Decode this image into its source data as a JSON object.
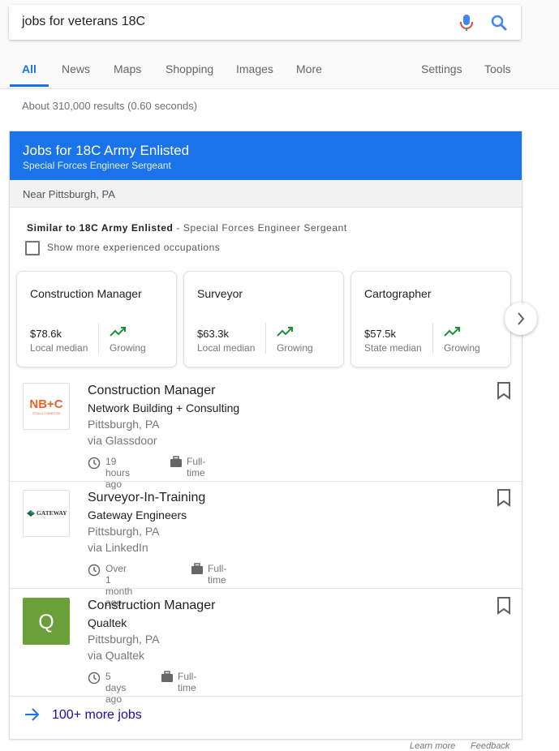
{
  "search": {
    "query": "jobs for veterans 18C"
  },
  "tabs": [
    {
      "label": "All"
    },
    {
      "label": "News"
    },
    {
      "label": "Maps"
    },
    {
      "label": "Shopping"
    },
    {
      "label": "Images"
    },
    {
      "label": "More"
    },
    {
      "label": "Settings"
    },
    {
      "label": "Tools"
    }
  ],
  "result_stats": "About 310,000 results (0.60 seconds)",
  "jobs_card": {
    "title": "Jobs for 18C Army Enlisted",
    "subtitle": "Special Forces Engineer Sergeant",
    "location": "Near Pittsburgh, PA",
    "similar_prefix": "Similar to 18C Army Enlisted",
    "similar_dash": " - ",
    "similar_occupation": "Special Forces Engineer Sergeant",
    "checkbox_label": "Show more experienced occupations",
    "checkbox_checked": false,
    "occupations": [
      {
        "title": "Construction Manager",
        "salary": "$78.6k",
        "salary_label": "Local median",
        "trend": "Growing"
      },
      {
        "title": "Surveyor",
        "salary": "$63.3k",
        "salary_label": "Local median",
        "trend": "Growing"
      },
      {
        "title": "Cartographer",
        "salary": "$57.5k",
        "salary_label": "State median",
        "trend": "Growing"
      }
    ],
    "jobs": [
      {
        "title": "Construction Manager",
        "company": "Network Building + Consulting",
        "location": "Pittsburgh, PA",
        "via": "via Glassdoor",
        "posted": "19 hours ago",
        "type": "Full-time",
        "logo_text": "NB+C",
        "logo_subtext": "TOTALLY CONNECTED"
      },
      {
        "title": "Surveyor-In-Training",
        "company": "Gateway Engineers",
        "location": "Pittsburgh, PA",
        "via": "via LinkedIn",
        "posted": "Over 1 month ago",
        "type": "Full-time",
        "logo_text": "GATEWAY"
      },
      {
        "title": "Construction Manager",
        "company": "Qualtek",
        "location": "Pittsburgh, PA",
        "via": "via Qualtek",
        "posted": "5 days ago",
        "type": "Full-time",
        "logo_text": "Q"
      }
    ],
    "more_jobs": "100+ more jobs"
  },
  "footer": {
    "learn_more": "Learn more",
    "feedback": "Feedback"
  },
  "colors": {
    "accent": "#1a73e8",
    "trend_green": "#1e8e3e",
    "qualtek_green": "#6a9f3a",
    "link": "#1a0dab"
  },
  "icons": [
    "mic-icon",
    "search-icon",
    "trending-up-icon",
    "chevron-right-icon",
    "bookmark-icon",
    "clock-icon",
    "briefcase-icon",
    "arrow-right-icon"
  ]
}
